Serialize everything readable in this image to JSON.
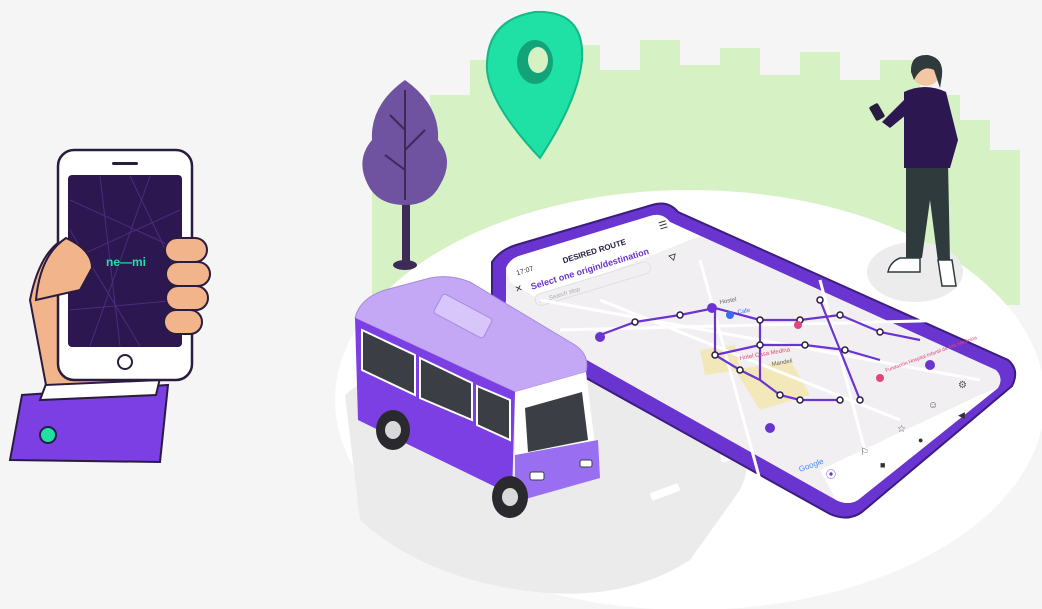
{
  "logo": {
    "text": "ne—mi"
  },
  "phone_screen": {
    "status_time": "17:07",
    "title": "DESIRED ROUTE",
    "subtitle": "Select one origin/destination",
    "search_placeholder": "Search stop",
    "map_labels": {
      "hostel": "Hostel",
      "hotel": "Hotel Casa Medina",
      "mandeli": "Mandeli",
      "hospital": "Fundación Hospital Infantil de Alta Medicina",
      "cafe": "Cafe"
    },
    "google": "Google"
  },
  "colors": {
    "purple": "#7b3fe4",
    "lavender": "#b89cef",
    "mint": "#1fe0a5",
    "grass": "#d6f2c4",
    "ground": "#ffffff"
  }
}
